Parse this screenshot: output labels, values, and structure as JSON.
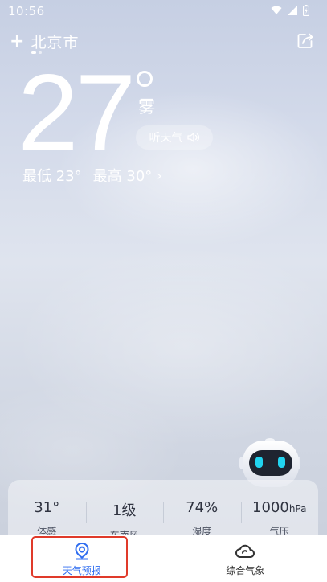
{
  "status_bar": {
    "time": "10:56",
    "icons": [
      "wifi-icon",
      "signal-icon",
      "battery-icon"
    ]
  },
  "header": {
    "add_icon": "+",
    "city": "北京市",
    "page_count": 2,
    "active_page": 0,
    "share_icon": "share-icon"
  },
  "current": {
    "temperature": "27",
    "condition": "雾",
    "listen_label": "听天气",
    "low_label": "最低 23°",
    "high_label": "最高 30°",
    "range_chevron": "›"
  },
  "details": [
    {
      "value": "31°",
      "unit": "",
      "label": "体感"
    },
    {
      "value": "1级",
      "unit": "",
      "label": "东南风"
    },
    {
      "value": "74%",
      "unit": "",
      "label": "湿度"
    },
    {
      "value": "1000",
      "unit": "hPa",
      "label": "气压"
    }
  ],
  "nav": {
    "tabs": [
      {
        "label": "天气预报",
        "icon": "location-pin-icon",
        "active": true
      },
      {
        "label": "综合气象",
        "icon": "cloud-icon",
        "active": false
      }
    ]
  },
  "colors": {
    "accent": "#2f6df0",
    "highlight": "#e03a2a",
    "robot_eye": "#21d4f0"
  }
}
